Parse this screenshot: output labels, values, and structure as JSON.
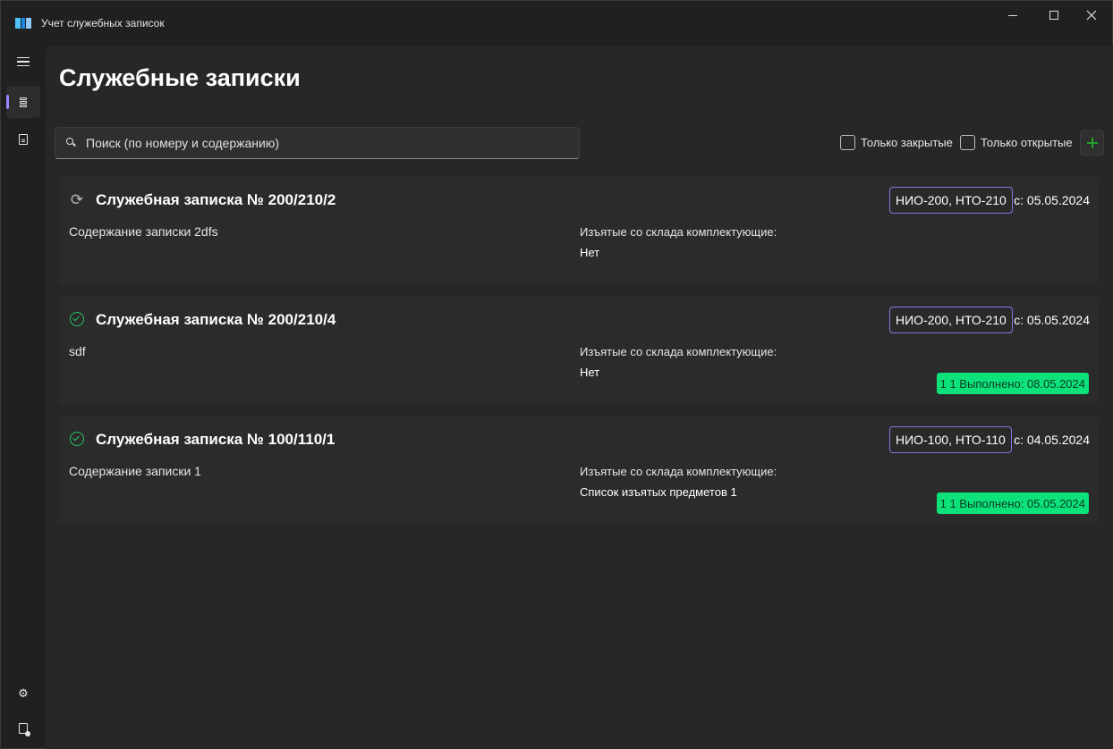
{
  "window": {
    "title": "Учет служебных записок"
  },
  "page": {
    "title": "Служебные записки"
  },
  "search": {
    "placeholder": "Поиск (по номеру и содержанию)",
    "value": ""
  },
  "filters": {
    "closed_label": "Только закрытые",
    "open_label": "Только открытые"
  },
  "sidebar": {
    "items": [
      {
        "icon": "hamburger-icon"
      },
      {
        "icon": "notes-list-icon",
        "active": true
      },
      {
        "icon": "document-icon"
      },
      {
        "icon": "gear-icon"
      },
      {
        "icon": "document-status-icon"
      }
    ]
  },
  "colors": {
    "accent": "#9c84ff",
    "tag_border": "#8c73e6",
    "done_badge": "#0de27a",
    "status_ok": "#22c55e"
  },
  "cards": [
    {
      "status": "in-progress",
      "title": "Служебная записка № 200/210/2",
      "tag": "НИО-200, НТО-210",
      "date": "с: 05.05.2024",
      "body": "Содержание записки 2dfs",
      "items_label": "Изъятые со склада комплектующие:",
      "items_value": "Нет",
      "done": ""
    },
    {
      "status": "done",
      "title": "Служебная записка № 200/210/4",
      "tag": "НИО-200, НТО-210",
      "date": "с: 05.05.2024",
      "body": "sdf",
      "items_label": "Изъятые со склада комплектующие:",
      "items_value": "Нет",
      "done": "1 1 Выполнено: 08.05.2024"
    },
    {
      "status": "done",
      "title": "Служебная записка № 100/110/1",
      "tag": "НИО-100, НТО-110",
      "date": "с: 04.05.2024",
      "body": "Содержание записки 1",
      "items_label": "Изъятые со склада комплектующие:",
      "items_value": "Список изъятых предметов 1",
      "done": "1 1 Выполнено: 05.05.2024"
    }
  ]
}
